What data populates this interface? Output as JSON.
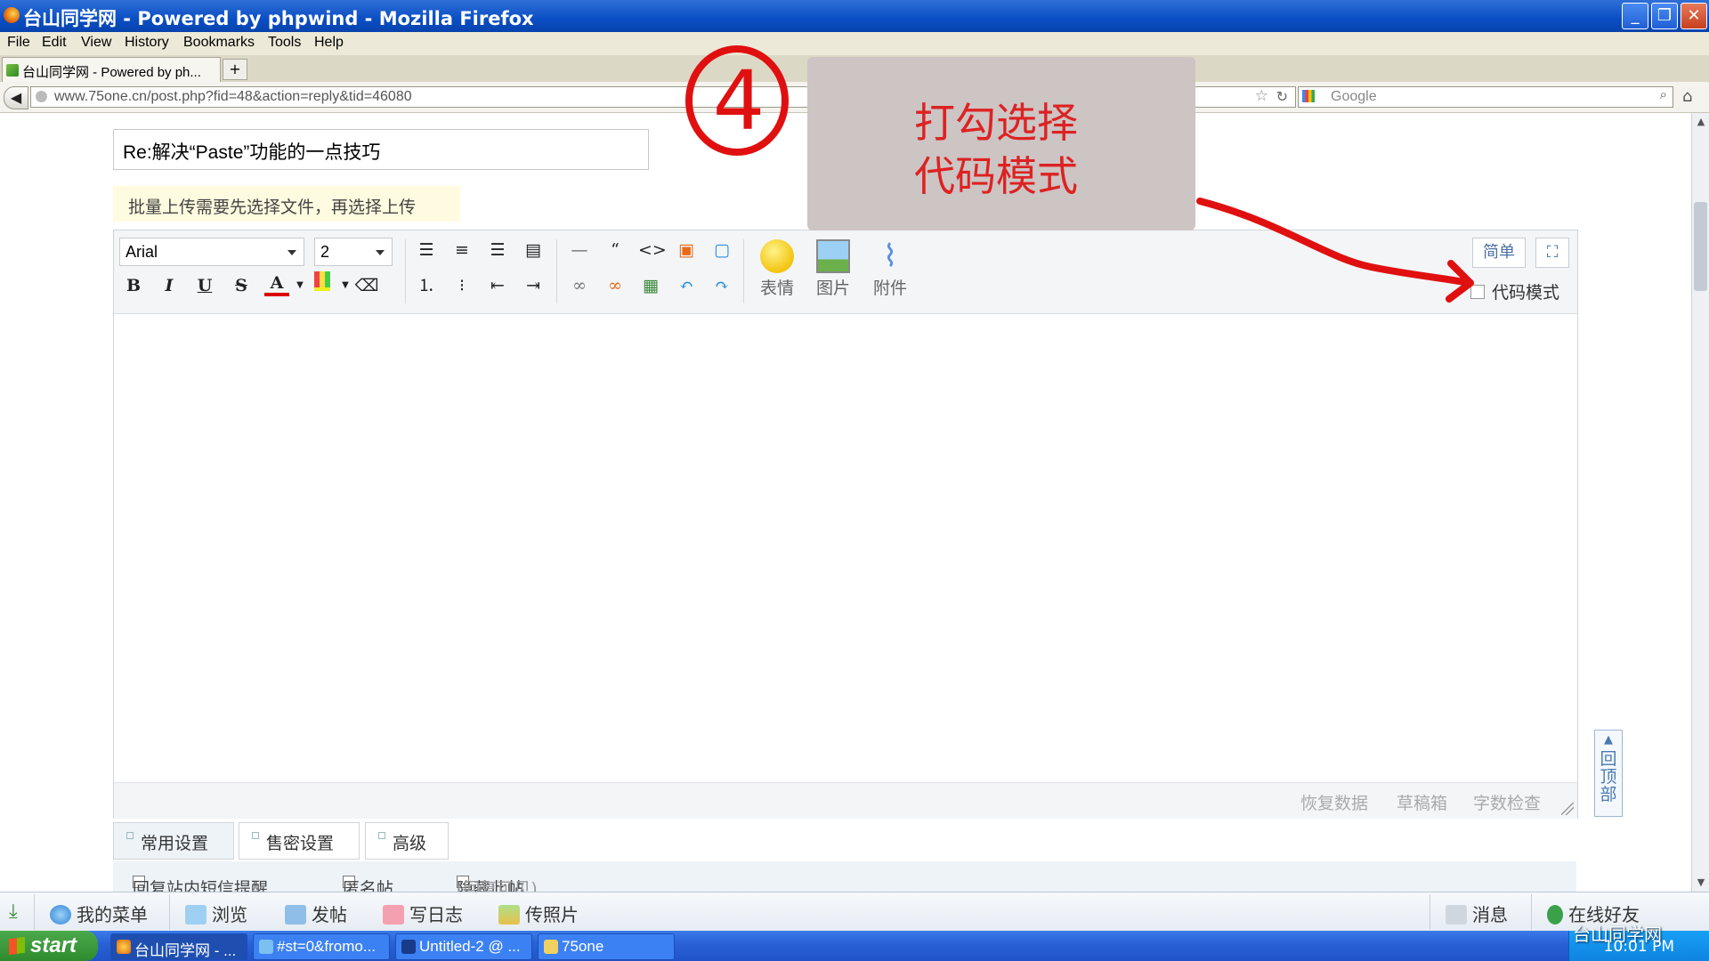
{
  "window": {
    "title": "台山同学网 - Powered by phpwind - Mozilla Firefox"
  },
  "menubar": {
    "items": [
      "File",
      "Edit",
      "View",
      "History",
      "Bookmarks",
      "Tools",
      "Help"
    ]
  },
  "tabs": [
    {
      "label": "台山同学网 - Powered by ph..."
    }
  ],
  "newtab_label": "+",
  "nav": {
    "url": "www.75one.cn/post.php?fid=48&action=reply&tid=46080",
    "search_placeholder": "Google"
  },
  "post": {
    "subject": "Re:解决“Paste”功能的一点技巧",
    "upload_tip": "批量上传需要先选择文件，再选择上传"
  },
  "editor": {
    "font": "Arial",
    "size": "2",
    "buttons": {
      "emoticon": "表情",
      "image": "图片",
      "attachment": "附件",
      "simple": "简单"
    },
    "code_mode_label": "代码模式",
    "footer": {
      "restore": "恢复数据",
      "drafts": "草稿箱",
      "wordcount": "字数检查"
    }
  },
  "settings_tabs": [
    "常用设置",
    "售密设置",
    "高级"
  ],
  "options": {
    "opt1": "回复站内短信提醒",
    "opt2": "匿名帖",
    "opt3": "隐藏此帖",
    "opt3_note": "(回复可见)"
  },
  "back_to_top": "回顶部",
  "annotation": {
    "step_number": "4",
    "line1": "打勾选择",
    "line2": "代码模式",
    "ink_color": "#e01010"
  },
  "sitebar": {
    "menu": "我的菜单",
    "browse": "浏览",
    "post": "发帖",
    "diary": "写日志",
    "photo": "传照片",
    "messages": "消息",
    "friends": "在线好友"
  },
  "taskbar": {
    "start": "start",
    "tasks": [
      "台山同学网 - ...",
      "#st=0&fromo...",
      "Untitled-2 @ ...",
      "75one"
    ],
    "clock": "10:01 PM",
    "tray_logo": "台山同学网"
  }
}
